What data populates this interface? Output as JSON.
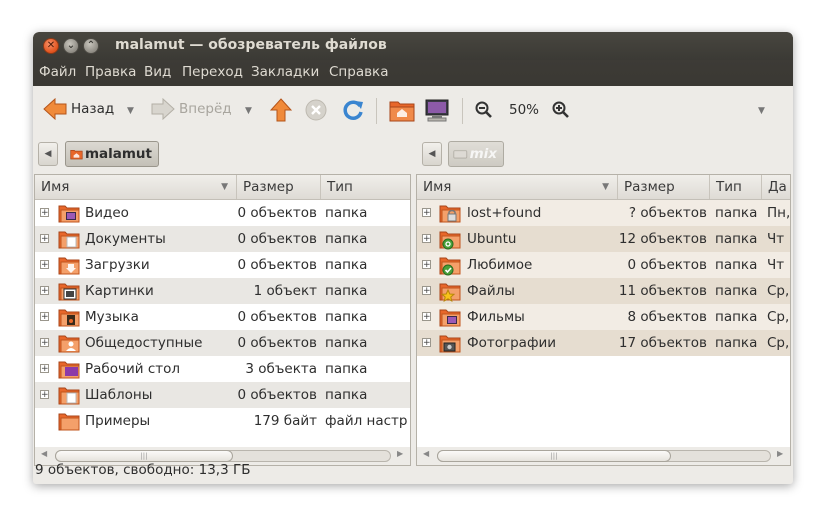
{
  "window": {
    "title": "malamut — обозреватель файлов"
  },
  "menubar": [
    "Файл",
    "Правка",
    "Вид",
    "Переход",
    "Закладки",
    "Справка"
  ],
  "toolbar": {
    "back_label": "Назад",
    "forward_label": "Вперёд",
    "zoom_value": "50%"
  },
  "left_pane": {
    "location": "malamut",
    "columns": [
      "Имя",
      "Размер",
      "Тип"
    ],
    "rows": [
      {
        "name": "Видео",
        "size": "0 объектов",
        "type": "папка",
        "icon": "video-folder-icon"
      },
      {
        "name": "Документы",
        "size": "0 объектов",
        "type": "папка",
        "icon": "documents-folder-icon"
      },
      {
        "name": "Загрузки",
        "size": "0 объектов",
        "type": "папка",
        "icon": "downloads-folder-icon"
      },
      {
        "name": "Картинки",
        "size": "1 объект",
        "type": "папка",
        "icon": "pictures-folder-icon"
      },
      {
        "name": "Музыка",
        "size": "0 объектов",
        "type": "папка",
        "icon": "music-folder-icon"
      },
      {
        "name": "Общедоступные",
        "size": "0 объектов",
        "type": "папка",
        "icon": "public-folder-icon"
      },
      {
        "name": "Рабочий стол",
        "size": "3 объекта",
        "type": "папка",
        "icon": "desktop-folder-icon"
      },
      {
        "name": "Шаблоны",
        "size": "0 объектов",
        "type": "папка",
        "icon": "templates-folder-icon"
      },
      {
        "name": "Примеры",
        "size": "179 байт",
        "type": "файл настр",
        "icon": "examples-folder-icon"
      }
    ]
  },
  "right_pane": {
    "location": "mix",
    "columns": [
      "Имя",
      "Размер",
      "Тип",
      "Да"
    ],
    "rows": [
      {
        "name": "lost+found",
        "size": "? объектов",
        "type": "папка",
        "date": "Пн,",
        "icon": "locked-folder-icon"
      },
      {
        "name": "Ubuntu",
        "size": "12 объектов",
        "type": "папка",
        "date": "Чт",
        "icon": "ubuntu-folder-icon"
      },
      {
        "name": "Любимое",
        "size": "0 объектов",
        "type": "папка",
        "date": "Чт",
        "icon": "checked-folder-icon"
      },
      {
        "name": "Файлы",
        "size": "11 объектов",
        "type": "папка",
        "date": "Ср,",
        "icon": "star-folder-icon"
      },
      {
        "name": "Фильмы",
        "size": "8 объектов",
        "type": "папка",
        "date": "Ср,",
        "icon": "video-folder-icon"
      },
      {
        "name": "Фотографии",
        "size": "17 объектов",
        "type": "папка",
        "date": "Ср,",
        "icon": "camera-folder-icon"
      }
    ]
  },
  "status": "9 объектов, свободно: 13,3 ГБ",
  "colors": {
    "titlebar": "#3c3b37",
    "folder_orange": "#e8672a",
    "row_alt": "#e9e7e3",
    "right_row_highlight": "#e6ddd0"
  }
}
